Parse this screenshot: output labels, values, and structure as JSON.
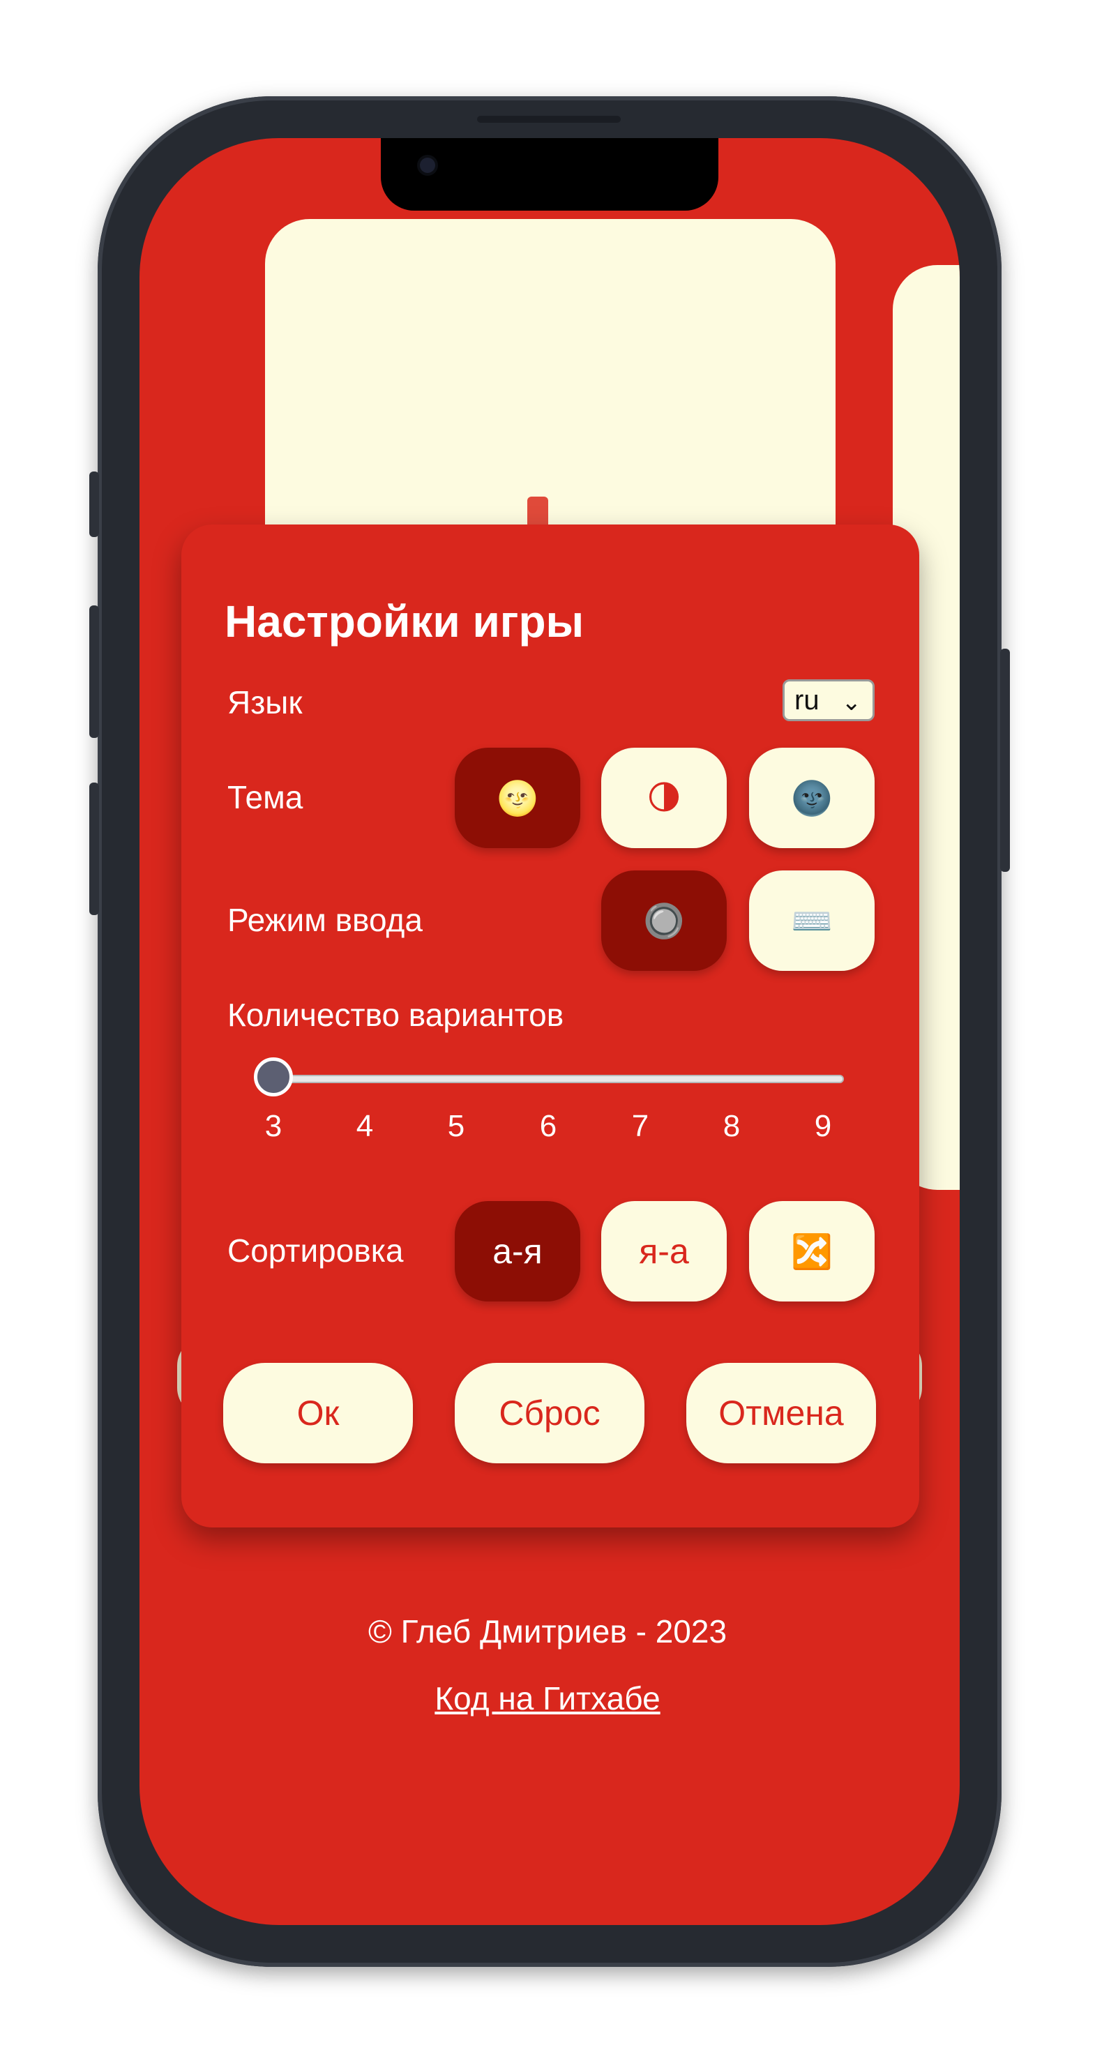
{
  "settings": {
    "title": "Настройки игры",
    "language": {
      "label": "Язык",
      "value": "ru",
      "chevron": "⌄"
    },
    "theme": {
      "label": "Тема",
      "options": [
        {
          "icon": "full-moon-face-icon",
          "glyph": "🌝",
          "active": true
        },
        {
          "icon": "half-moon-icon",
          "glyph": "🌗",
          "active": false
        },
        {
          "icon": "new-moon-face-icon",
          "glyph": "🌚",
          "active": false
        }
      ]
    },
    "input_mode": {
      "label": "Режим ввода",
      "options": [
        {
          "icon": "radio-button-icon",
          "glyph": "🔘",
          "active": true
        },
        {
          "icon": "keyboard-icon",
          "glyph": "⌨️",
          "active": false
        }
      ]
    },
    "variants": {
      "label": "Количество вариантов",
      "ticks": [
        "3",
        "4",
        "5",
        "6",
        "7",
        "8",
        "9"
      ],
      "value": 3
    },
    "sorting": {
      "label": "Сортировка",
      "options": [
        {
          "label": "а-я",
          "active": true
        },
        {
          "label": "я-а",
          "active": false
        },
        {
          "icon": "shuffle-icon",
          "glyph": "🔀",
          "active": false
        }
      ]
    },
    "buttons": {
      "ok": "Ок",
      "reset": "Сброс",
      "cancel": "Отмена"
    }
  },
  "footer": {
    "copyright": "© Глеб Дмитриев - 2023",
    "link": "Код на Гитхабе"
  },
  "colors": {
    "background": "#d9271d",
    "card": "#fdfbe0",
    "active": "#8d0e05",
    "text": "#ffffff"
  }
}
